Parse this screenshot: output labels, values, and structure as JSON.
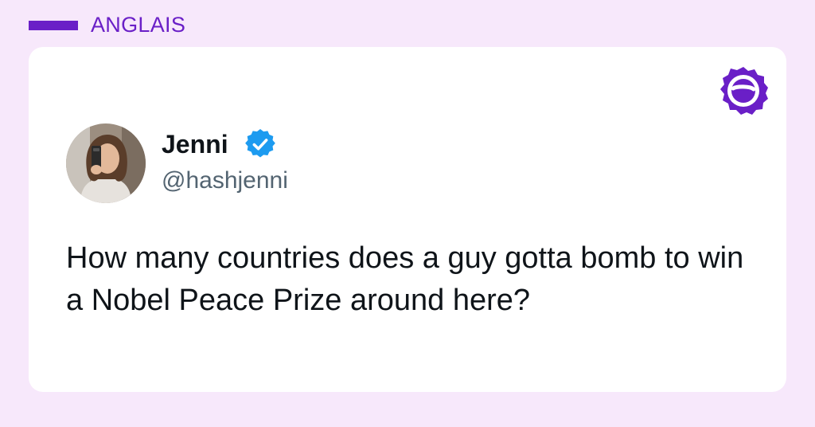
{
  "header": {
    "language_label": "ANGLAIS"
  },
  "tweet": {
    "author_name": "Jenni",
    "author_handle": "@hashjenni",
    "verified": true,
    "text": "How many countries does a guy gotta bomb to win a Nobel Peace Prize around here?"
  },
  "icons": {
    "brand": "brand-logo-icon",
    "verified": "verified-badge-icon"
  },
  "colors": {
    "page_background": "#f7e8fb",
    "accent": "#6a1fc7",
    "card_background": "#ffffff",
    "verified_blue": "#1d9bf0",
    "text_primary": "#0f1419",
    "text_secondary": "#536471"
  }
}
